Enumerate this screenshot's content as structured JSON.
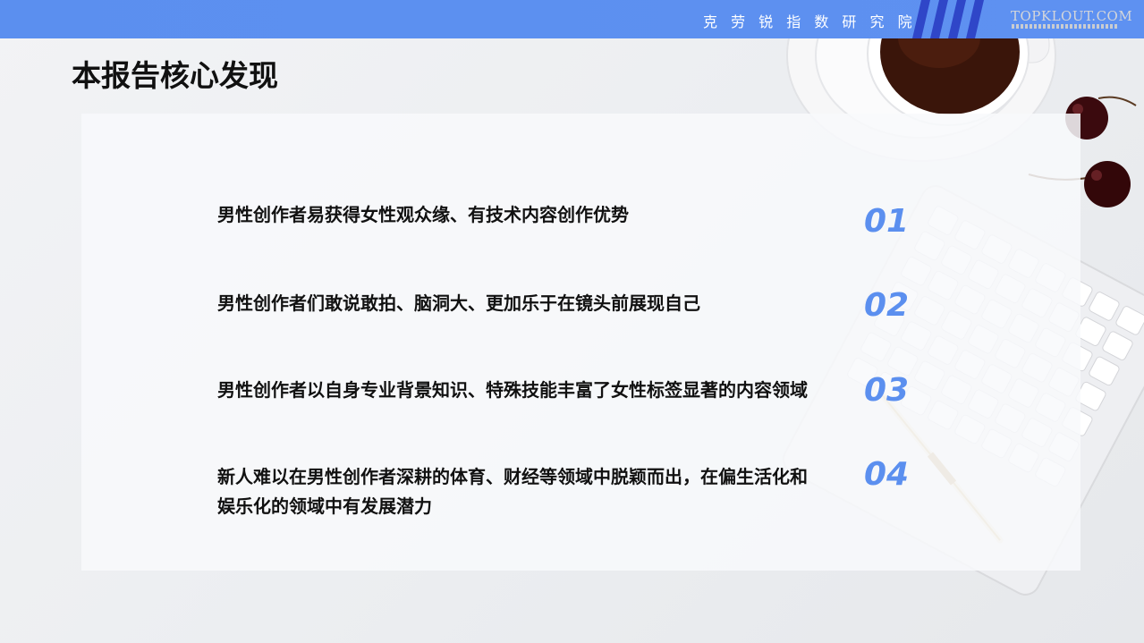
{
  "header": {
    "institute": "克 劳 锐 指 数 研 究 院",
    "brand": "TOPKLOUT.COM"
  },
  "page_title": "本报告核心发现",
  "findings": [
    {
      "num": "01",
      "text": "男性创作者易获得女性观众缘、有技术内容创作优势"
    },
    {
      "num": "02",
      "text": "男性创作者们敢说敢拍、脑洞大、更加乐于在镜头前展现自己"
    },
    {
      "num": "03",
      "text": "男性创作者以自身专业背景知识、特殊技能丰富了女性标签显著的内容领域"
    },
    {
      "num": "04",
      "text": "新人难以在男性创作者深耕的体育、财经等领域中脱颖而出，在偏生活化和娱乐化的领域中有发展潜力"
    }
  ],
  "colors": {
    "accent": "#5b8fef",
    "stripe": "#2f46c8",
    "title": "#111111"
  }
}
